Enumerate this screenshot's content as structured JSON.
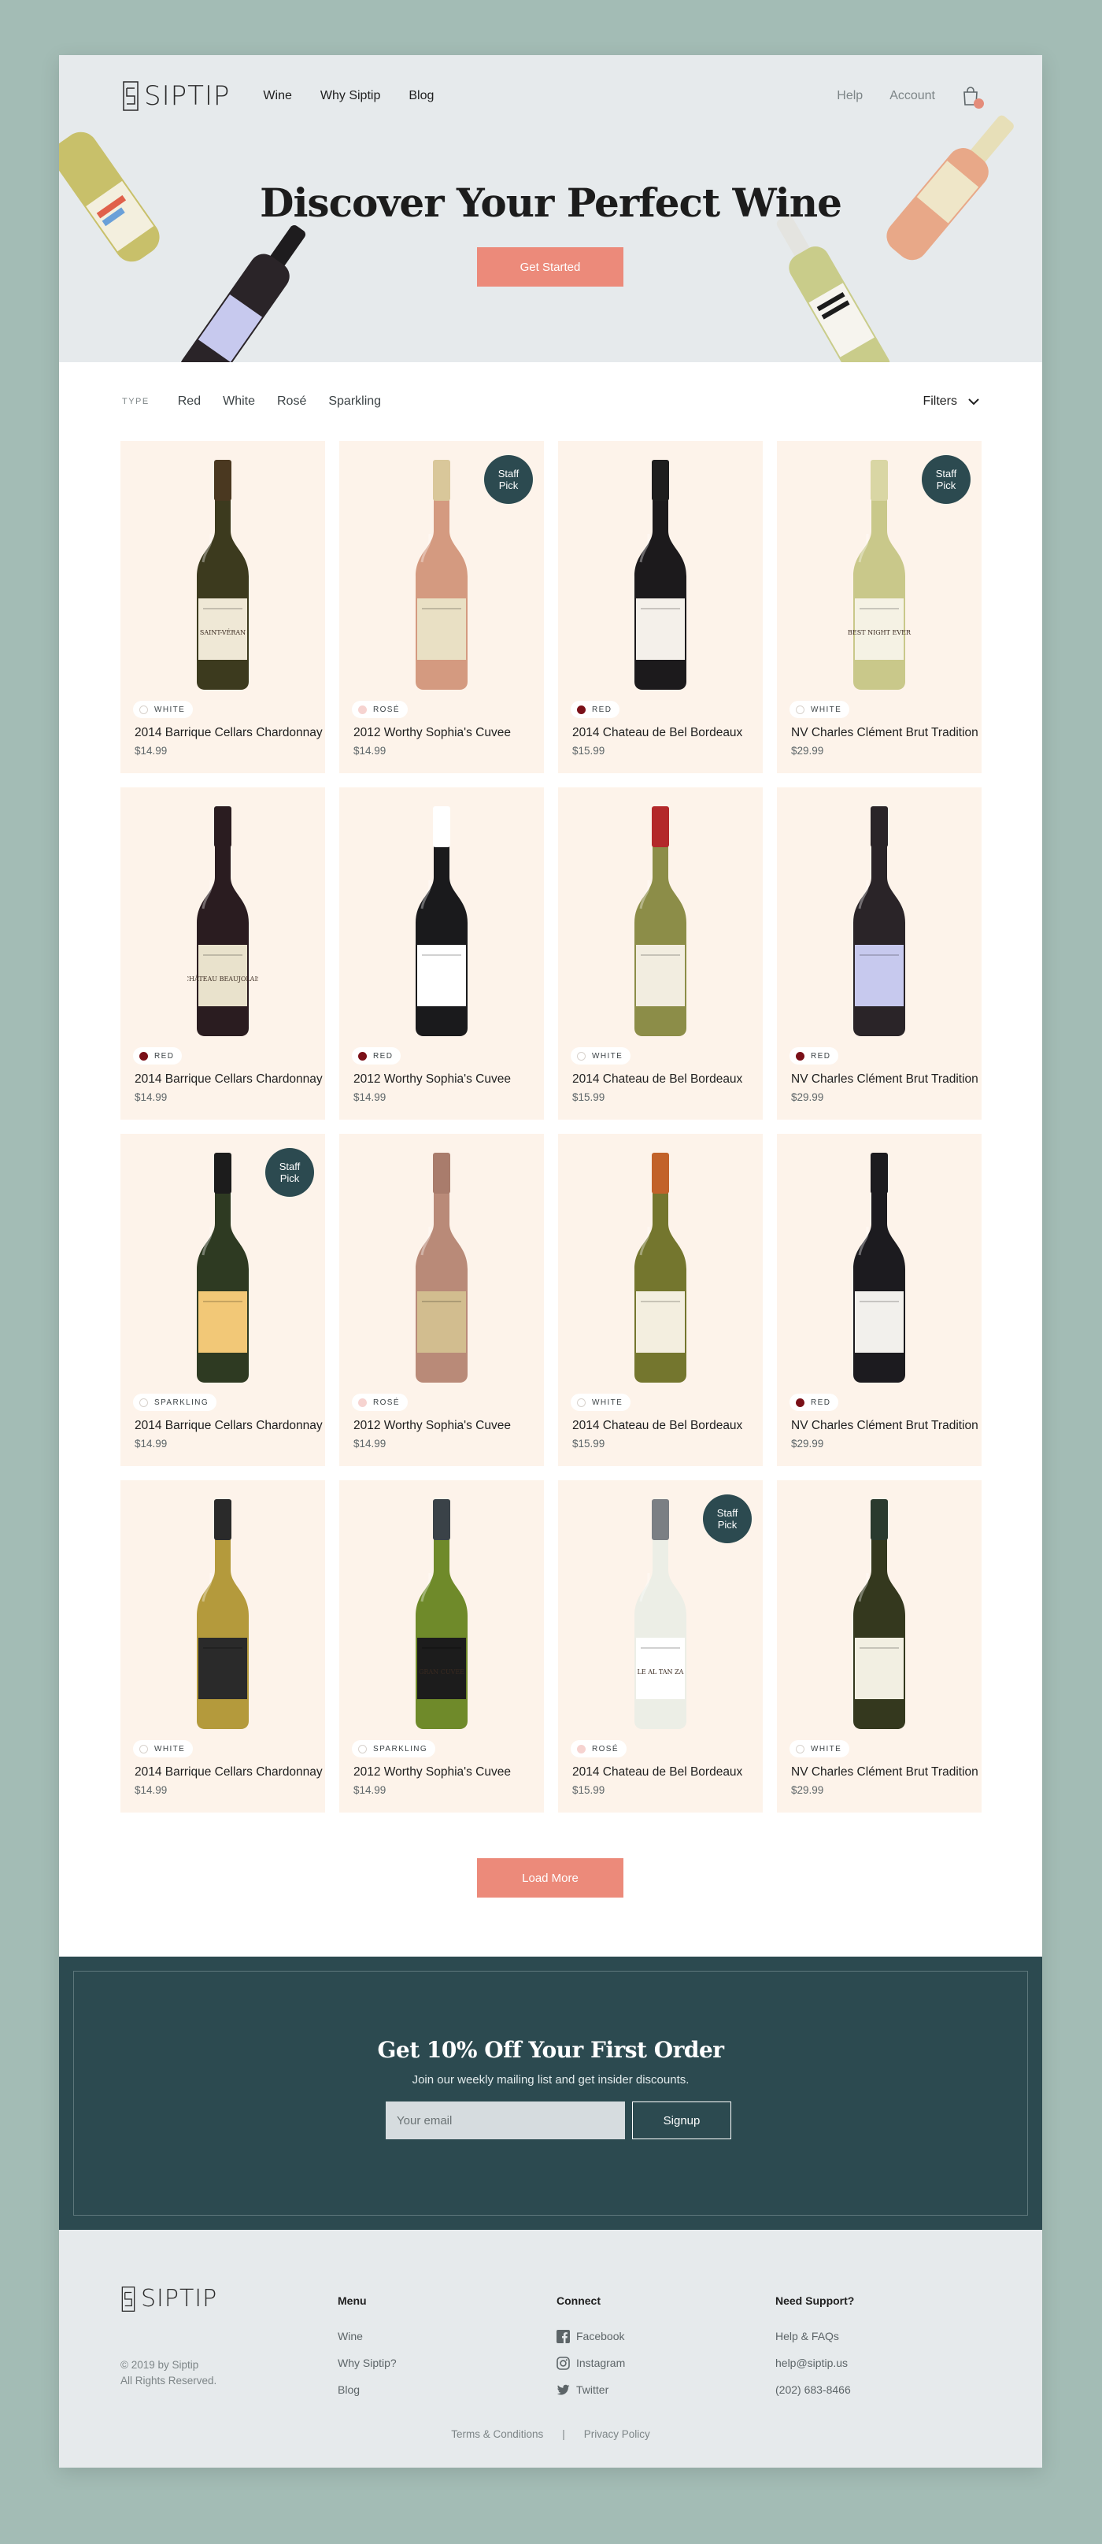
{
  "brand": {
    "name": "SIPTIP"
  },
  "nav": {
    "links": [
      "Wine",
      "Why Siptip",
      "Blog"
    ],
    "help": "Help",
    "account": "Account"
  },
  "hero": {
    "title": "Discover Your Perfect Wine",
    "cta": "Get Started"
  },
  "filters": {
    "type_label": "TYPE",
    "types": [
      "Red",
      "White",
      "Rosé",
      "Sparkling"
    ],
    "filters_button": "Filters"
  },
  "type_colors": {
    "WHITE": "#ffffff",
    "ROSÉ": "#f6d3d0",
    "RED": "#7a1018",
    "SPARKLING": "#ffffff"
  },
  "products": [
    {
      "name": "2014 Barrique Cellars Chardonnay",
      "price": "$14.99",
      "type": "WHITE",
      "staff_pick": false,
      "bottle": {
        "glass": "#3c3a1e",
        "label": "#efe8d6",
        "label_text": "SAINT-VÉRAN",
        "cap": "#4a3820"
      }
    },
    {
      "name": "2012 Worthy Sophia's Cuvee",
      "price": "$14.99",
      "type": "ROSÉ",
      "staff_pick": true,
      "bottle": {
        "glass": "#d49a80",
        "label": "#e9e0c4",
        "label_text": "",
        "cap": "#d9c79a"
      }
    },
    {
      "name": "2014 Chateau de Bel Bordeaux",
      "price": "$15.99",
      "type": "RED",
      "staff_pick": false,
      "bottle": {
        "glass": "#1c1a1c",
        "label": "#f4f0ea",
        "label_text": "",
        "cap": "#1e1e1e"
      }
    },
    {
      "name": "NV Charles Clément Brut Tradition",
      "price": "$29.99",
      "type": "WHITE",
      "staff_pick": true,
      "bottle": {
        "glass": "#c9c88a",
        "label": "#f5f2e4",
        "label_text": "BEST NIGHT EVER",
        "cap": "#d9d6a4"
      }
    },
    {
      "name": "2014 Barrique Cellars Chardonnay",
      "price": "$14.99",
      "type": "RED",
      "staff_pick": false,
      "bottle": {
        "glass": "#2a1c20",
        "label": "#e9e2cc",
        "label_text": "CHÂTEAU BEAUJOLAIS",
        "cap": "#2a1c20"
      }
    },
    {
      "name": "2012 Worthy Sophia's Cuvee",
      "price": "$14.99",
      "type": "RED",
      "staff_pick": false,
      "bottle": {
        "glass": "#1a1a1c",
        "label": "#ffffff",
        "label_text": "",
        "cap": "#ffffff"
      }
    },
    {
      "name": "2014 Chateau de Bel Bordeaux",
      "price": "$15.99",
      "type": "WHITE",
      "staff_pick": false,
      "bottle": {
        "glass": "#8c8d48",
        "label": "#f2ede0",
        "label_text": "",
        "cap": "#b3282a"
      }
    },
    {
      "name": "NV Charles Clément Brut Tradition",
      "price": "$29.99",
      "type": "RED",
      "staff_pick": false,
      "bottle": {
        "glass": "#2a2428",
        "label": "#c7c9ee",
        "label_text": "",
        "cap": "#2a2428"
      }
    },
    {
      "name": "2014 Barrique Cellars Chardonnay",
      "price": "$14.99",
      "type": "SPARKLING",
      "staff_pick": true,
      "bottle": {
        "glass": "#2e3a22",
        "label": "#f2c877",
        "label_text": "",
        "cap": "#1c1c1c"
      }
    },
    {
      "name": "2012 Worthy Sophia's Cuvee",
      "price": "$14.99",
      "type": "ROSÉ",
      "staff_pick": false,
      "bottle": {
        "glass": "#b98a78",
        "label": "#d2bd8f",
        "label_text": "",
        "cap": "#a97c6c"
      }
    },
    {
      "name": "2014 Chateau de Bel Bordeaux",
      "price": "$15.99",
      "type": "WHITE",
      "staff_pick": false,
      "bottle": {
        "glass": "#74762e",
        "label": "#f3eedf",
        "label_text": "",
        "cap": "#c2622a"
      }
    },
    {
      "name": "NV Charles Clément Brut Tradition",
      "price": "$29.99",
      "type": "RED",
      "staff_pick": false,
      "bottle": {
        "glass": "#1c1b1f",
        "label": "#f2f0ec",
        "label_text": "",
        "cap": "#1c1b1f"
      }
    },
    {
      "name": "2014 Barrique Cellars Chardonnay",
      "price": "$14.99",
      "type": "WHITE",
      "staff_pick": false,
      "bottle": {
        "glass": "#b49a3c",
        "label": "#2a2a2a",
        "label_text": "",
        "cap": "#2a2a2a"
      }
    },
    {
      "name": "2012 Worthy Sophia's Cuvee",
      "price": "$14.99",
      "type": "SPARKLING",
      "staff_pick": false,
      "bottle": {
        "glass": "#6f8a2a",
        "label": "#1c1c1c",
        "label_text": "GRAN CUVEE",
        "cap": "#3a4248"
      }
    },
    {
      "name": "2014 Chateau de Bel Bordeaux",
      "price": "$15.99",
      "type": "ROSÉ",
      "staff_pick": true,
      "bottle": {
        "glass": "#eceee6",
        "label": "#ffffff",
        "label_text": "LE AL TAN ZA",
        "cap": "#7b7f84"
      }
    },
    {
      "name": "NV Charles Clément Brut Tradition",
      "price": "$29.99",
      "type": "WHITE",
      "staff_pick": false,
      "bottle": {
        "glass": "#34381e",
        "label": "#f2efe2",
        "label_text": "",
        "cap": "#2a3a2e"
      }
    }
  ],
  "staff_pick_label": "Staff\nPick",
  "load_more": "Load More",
  "newsletter": {
    "title": "Get 10% Off Your First Order",
    "subtitle": "Join our weekly mailing list and get insider discounts.",
    "placeholder": "Your email",
    "button": "Signup"
  },
  "footer": {
    "copyright_1": "© 2019 by Siptip",
    "copyright_2": "All Rights Reserved.",
    "menu": {
      "heading": "Menu",
      "links": [
        "Wine",
        "Why Siptip?",
        "Blog"
      ]
    },
    "connect": {
      "heading": "Connect",
      "links": [
        {
          "label": "Facebook",
          "icon": "facebook-icon"
        },
        {
          "label": "Instagram",
          "icon": "instagram-icon"
        },
        {
          "label": "Twitter",
          "icon": "twitter-icon"
        }
      ]
    },
    "support": {
      "heading": "Need Support?",
      "links": [
        "Help & FAQs",
        "help@siptip.us",
        "(202) 683-8466"
      ]
    },
    "terms": "Terms & Conditions",
    "separator": "|",
    "privacy": "Privacy Policy"
  },
  "colors": {
    "background": "#a3bcb5",
    "accent": "#ec8a7a",
    "dark_teal": "#2c4a50",
    "card_bg": "#fdf3ea"
  }
}
